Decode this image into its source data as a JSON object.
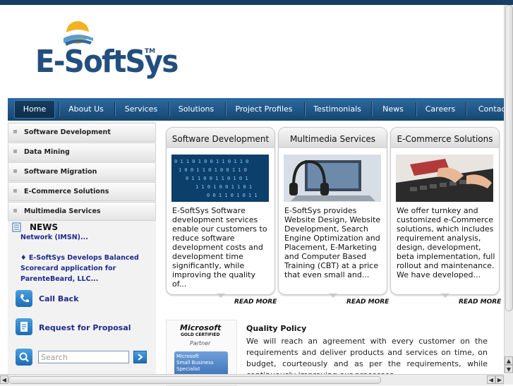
{
  "logo": {
    "text": "E-SoftSys",
    "tm": "TM"
  },
  "nav": {
    "items": [
      "Home",
      "About Us",
      "Services",
      "Solutions",
      "Project Profiles",
      "Testimonials",
      "News",
      "Careers",
      "Contact"
    ]
  },
  "sidebar": {
    "menu": [
      "Software Development",
      "Data Mining",
      "Software Migration",
      "E-Commerce Solutions",
      "Multimedia Services"
    ],
    "news_title": "NEWS",
    "news_items": [
      "Network (IMSN)...",
      "♦ E-SoftSys Develops Balanced",
      "Scorecard application for",
      "ParenteBeard, LLC..."
    ],
    "call_back": "Call Back",
    "request_proposal": "Request for Proposal",
    "search_placeholder": "Search"
  },
  "cards": [
    {
      "title": "Software Development",
      "lines": [
        "E-SoftSys Software",
        "development services",
        "enable our customers to",
        "reduce software",
        "development costs and",
        "development time",
        "significantly, while",
        "improving the quality of..."
      ]
    },
    {
      "title": "Multimedia Services",
      "lines": [
        "E-SoftSys provides",
        "Website Design, Website",
        "Development, Search",
        "Engine Optimization and",
        "Placement, E-Marketing",
        "and Computer Based",
        "Training (CBT) at a price",
        "that even small and..."
      ]
    },
    {
      "title": "E-Commerce Solutions",
      "lines": [
        "We offer turnkey and",
        "customized e-Commerce",
        "solutions, which includes",
        "requirement analysis,",
        "design, development,",
        "beta implementation, full",
        "rollout and maintenance.",
        "We have developed..."
      ]
    }
  ],
  "read_more": "READ MORE",
  "partner": {
    "logo": "Microsoft",
    "gold": "GOLD CERTIFIED",
    "partner": "Partner",
    "small_business": [
      "Microsoft",
      "Small Business",
      "Specialist"
    ]
  },
  "quality": {
    "title": "Quality Policy",
    "text": "We will reach an agreement with every customer on the requirements and deliver products and services on time, on budget, courteously and as per the requirements, while continuously improving our processes."
  },
  "colors": {
    "nav": "#1f5485",
    "link": "#1d2b8c",
    "accent": "#234e7e"
  }
}
